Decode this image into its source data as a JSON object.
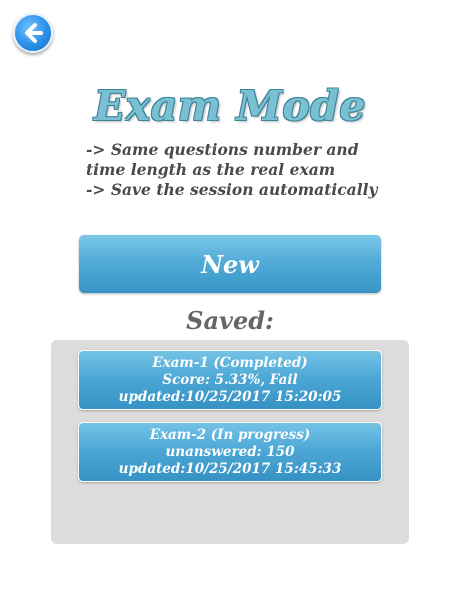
{
  "colors": {
    "accent": "#4ea8d6",
    "title": "#7ac0d3",
    "panel": "#dcdcdc"
  },
  "header": {
    "back_icon": "arrow-left-icon"
  },
  "title": "Exam Mode",
  "description": [
    "-> Same questions number and",
    "time length as the real exam",
    "-> Save the session automatically"
  ],
  "new_button": {
    "label": "New"
  },
  "saved": {
    "label": "Saved:",
    "sessions": [
      {
        "name": "Exam-1 (Completed)",
        "status": "Score: 5.33%, Fail",
        "updated": "updated:10/25/2017 15:20:05"
      },
      {
        "name": "Exam-2 (In progress)",
        "status": "unanswered: 150",
        "updated": "updated:10/25/2017 15:45:33"
      }
    ]
  }
}
